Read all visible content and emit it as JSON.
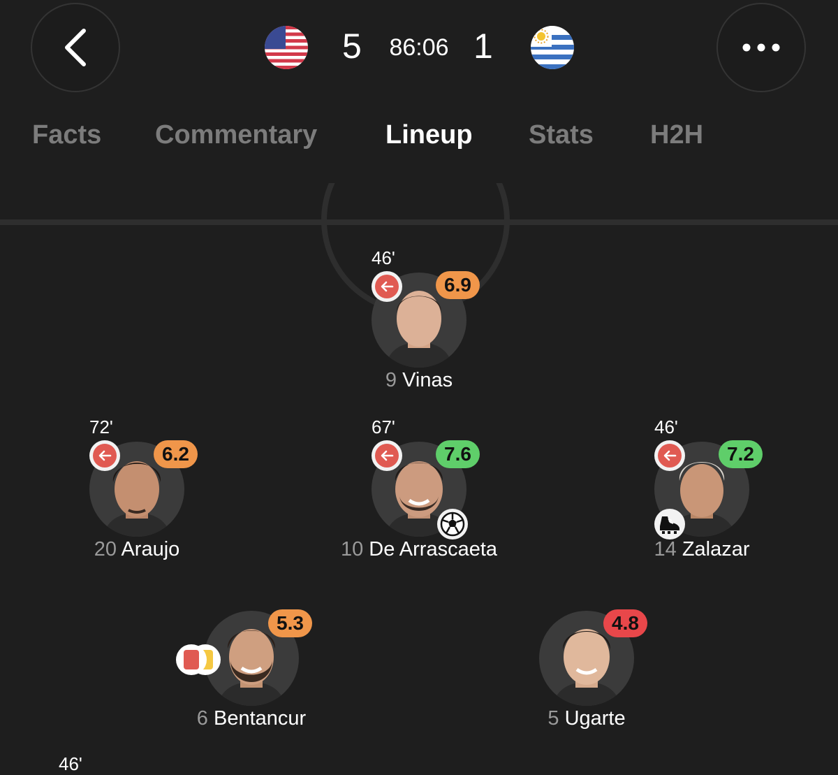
{
  "header": {
    "home_score": "5",
    "clock": "86:06",
    "away_score": "1",
    "home_flag_icon": "usa-flag-icon",
    "away_flag_icon": "uruguay-flag-icon"
  },
  "tabs": [
    {
      "label": "Facts",
      "active": false
    },
    {
      "label": "Commentary",
      "active": false
    },
    {
      "label": "Lineup",
      "active": true
    },
    {
      "label": "Stats",
      "active": false
    },
    {
      "label": "H2H",
      "active": false
    }
  ],
  "rating_colors": {
    "orange": "#f0964a",
    "green": "#5fce6a",
    "red": "#e8474a"
  },
  "players": [
    {
      "number": "9",
      "name": "Vinas",
      "rating": "6.9",
      "rating_color": "orange",
      "sub_time": "46'",
      "subbed_off": true
    },
    {
      "number": "20",
      "name": "Araujo",
      "rating": "6.2",
      "rating_color": "orange",
      "sub_time": "72'",
      "subbed_off": true
    },
    {
      "number": "10",
      "name": "De Arrascaeta",
      "rating": "7.6",
      "rating_color": "green",
      "sub_time": "67'",
      "subbed_off": true,
      "event_icon": "goal-ball-icon"
    },
    {
      "number": "14",
      "name": "Zalazar",
      "rating": "7.2",
      "rating_color": "green",
      "sub_time": "46'",
      "subbed_off": true,
      "event_icon": "assist-boot-icon"
    },
    {
      "number": "6",
      "name": "Bentancur",
      "rating": "5.3",
      "rating_color": "orange",
      "cards": [
        "red",
        "yellow"
      ]
    },
    {
      "number": "5",
      "name": "Ugarte",
      "rating": "4.8",
      "rating_color": "red"
    }
  ],
  "partial_next": {
    "sub_time": "46'"
  }
}
